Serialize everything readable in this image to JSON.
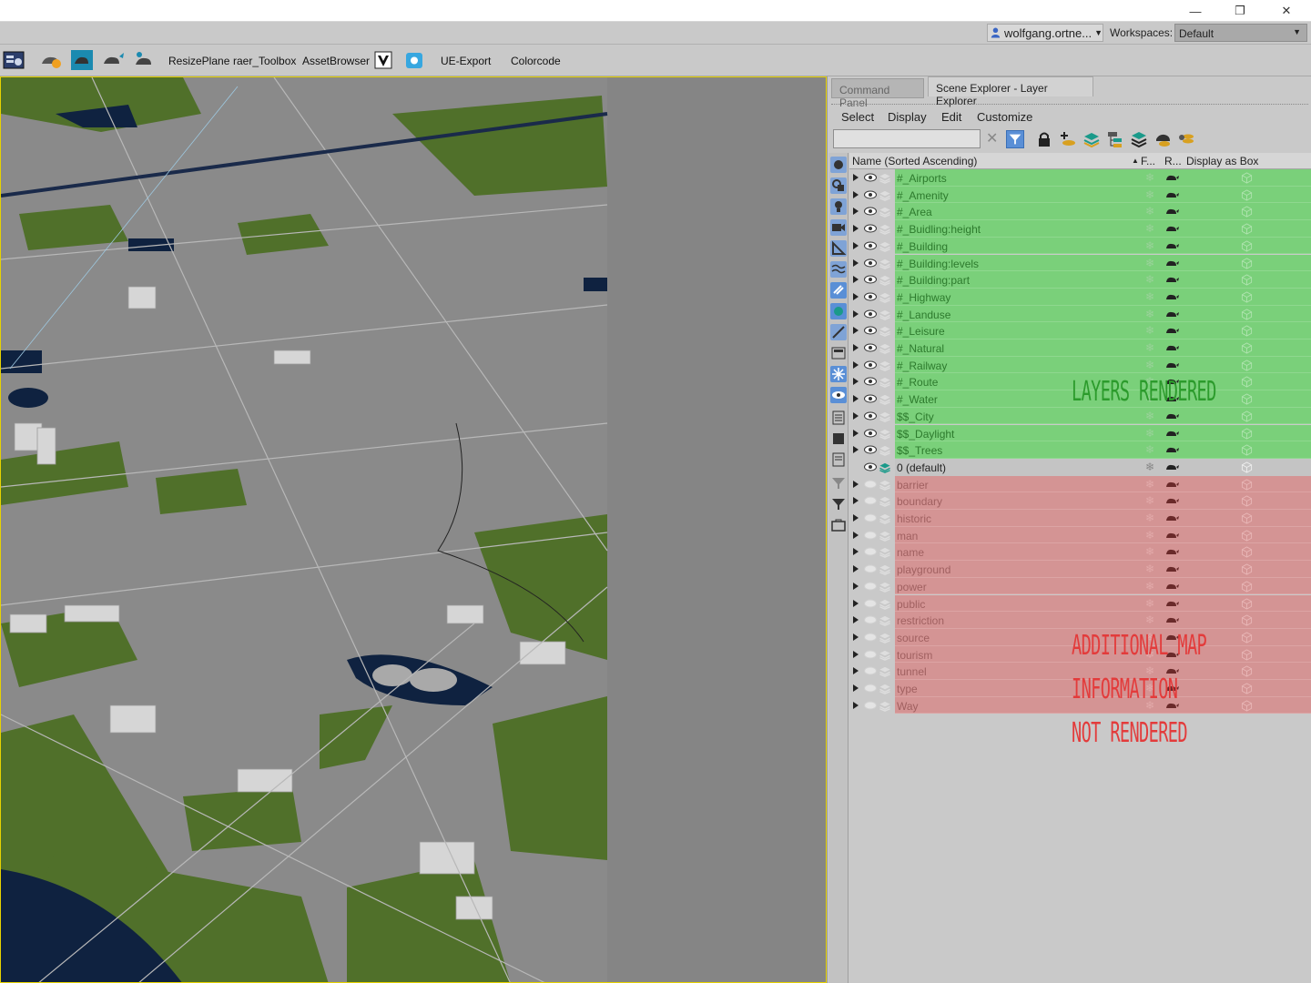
{
  "window": {
    "minimize_icon": "minimize-icon",
    "restore_icon": "restore-icon",
    "close_icon": "close-icon",
    "min_glyph": "—",
    "restore_glyph": "❐",
    "close_glyph": "✕"
  },
  "userbar": {
    "user": "wolfgang.ortne...",
    "user_arrow": "▼",
    "workspaces_label": "Workspaces:",
    "workspace": "Default",
    "workspace_arrow": "▼"
  },
  "toolbar": {
    "items": [
      "ResizePlane",
      "raer_Toolbox",
      "AssetBrowser",
      "UE-Export",
      "Colorcode"
    ]
  },
  "panel": {
    "tabs": [
      "Command Panel",
      "Scene Explorer - Layer Explorer"
    ],
    "menu": [
      "Select",
      "Display",
      "Edit",
      "Customize"
    ],
    "clear_glyph": "✕",
    "columns": {
      "name": "Name (Sorted Ascending)",
      "sort_arrow": "▲",
      "freeze": "F...",
      "render": "R...",
      "box": "Display as Box"
    },
    "freeze_glyph": "❄",
    "layers_rendered": [
      "#_Airports",
      "#_Amenity",
      "#_Area",
      "#_Buidling:height",
      "#_Building",
      "#_Building:levels",
      "#_Building:part",
      "#_Highway",
      "#_Landuse",
      "#_Leisure",
      "#_Natural",
      "#_Railway",
      "#_Route",
      "#_Water",
      "$$_City",
      "$$_Daylight",
      "$$_Trees"
    ],
    "default_layer": "0 (default)",
    "layers_not_rendered": [
      "barrier",
      "boundary",
      "historic",
      "man",
      "name",
      "playground",
      "power",
      "public",
      "restriction",
      "source",
      "tourism",
      "tunnel",
      "type",
      "Way"
    ],
    "annotation_rendered": "LAYERS RENDERED",
    "annotation_not_rendered": [
      "ADDITIONAL MAP",
      "INFORMATION",
      "NOT RENDERED"
    ]
  },
  "colors": {
    "rendered_bg": "#7ad07a",
    "not_rendered_bg": "#d49494",
    "viewport_border": "#e6d200",
    "active_tool": "#5a8fd6"
  }
}
